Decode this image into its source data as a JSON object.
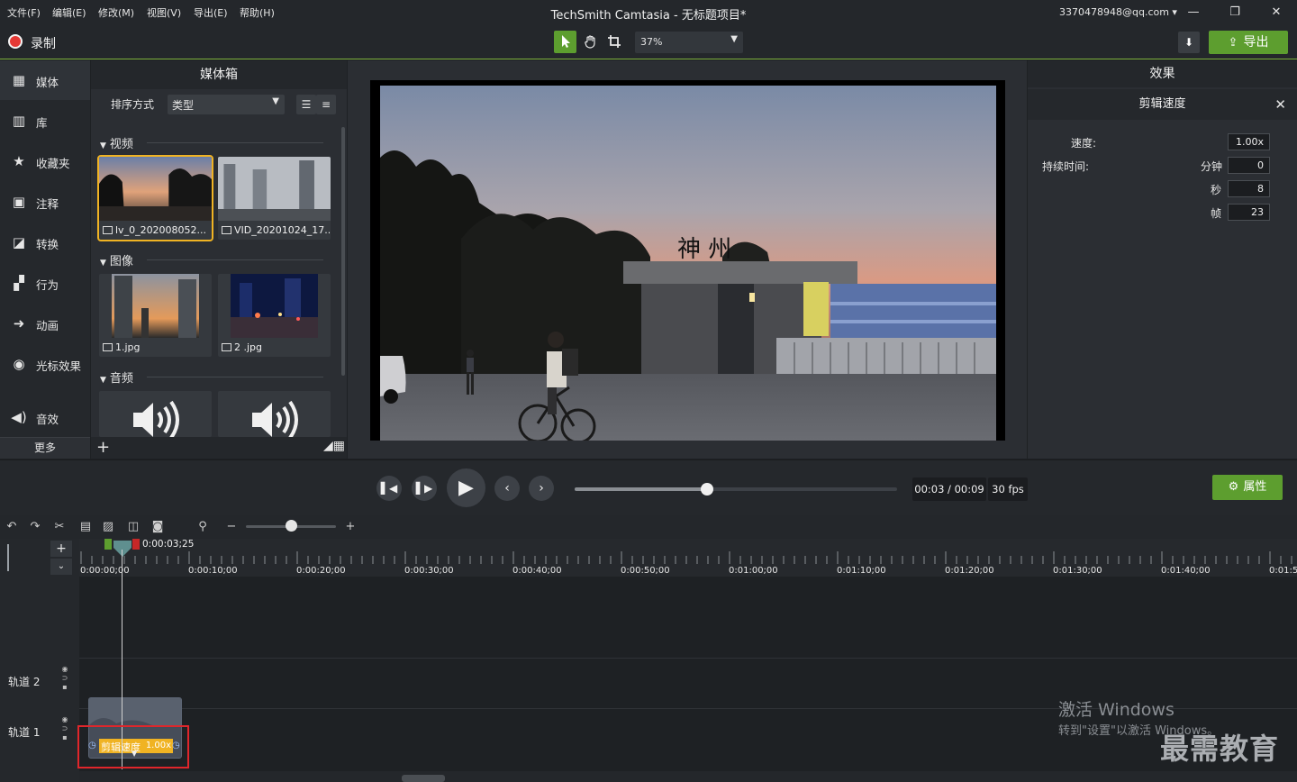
{
  "menu": [
    "文件(F)",
    "编辑(E)",
    "修改(M)",
    "视图(V)",
    "导出(E)",
    "帮助(H)"
  ],
  "app_title": "TechSmith Camtasia - 无标题项目*",
  "account": "3370478948@qq.com ▾",
  "window_controls": {
    "minimize": "—",
    "restore": "❐",
    "close": "✕"
  },
  "toolbar": {
    "record_label": "录制",
    "zoom": "37%",
    "export_label": "导出"
  },
  "nav": [
    {
      "label": "媒体",
      "icon": "media-icon"
    },
    {
      "label": "库",
      "icon": "library-icon"
    },
    {
      "label": "收藏夹",
      "icon": "star-icon"
    },
    {
      "label": "注释",
      "icon": "annotation-icon"
    },
    {
      "label": "转换",
      "icon": "transition-icon"
    },
    {
      "label": "行为",
      "icon": "behavior-icon"
    },
    {
      "label": "动画",
      "icon": "animation-icon"
    },
    {
      "label": "光标效果",
      "icon": "cursor-effect-icon"
    },
    {
      "label": "音效",
      "icon": "audio-effect-icon"
    }
  ],
  "nav_more": "更多",
  "media_bin": {
    "title": "媒体箱",
    "sort_label": "排序方式",
    "sort_value": "类型",
    "sections": {
      "video": "视频",
      "image": "图像",
      "audio": "音频"
    },
    "videos": [
      "lv_0_202008052...",
      "VID_20201024_17..."
    ],
    "images": [
      "1.jpg",
      "2 .jpg"
    ]
  },
  "properties": {
    "title": "效果",
    "subtitle": "剪辑速度",
    "speed_label": "速度:",
    "speed_value": "1.00x",
    "duration_label": "持续时间:",
    "minutes_label": "分钟",
    "minutes_value": "0",
    "seconds_label": "秒",
    "seconds_value": "8",
    "frames_label": "帧",
    "frames_value": "23"
  },
  "playback": {
    "time": "00:03 / 00:09",
    "fps": "30 fps",
    "properties_label": "属性",
    "progress": 0.41
  },
  "timeline": {
    "playhead_time": "0:00:03;25",
    "ticks": [
      "0:00:00;00",
      "0:00:10;00",
      "0:00:20;00",
      "0:00:30;00",
      "0:00:40;00",
      "0:00:50;00",
      "0:01:00;00",
      "0:01:10;00",
      "0:01:20;00",
      "0:01:30;00",
      "0:01:40;00",
      "0:01:5"
    ],
    "tracks": [
      "轨道 2",
      "轨道 1"
    ],
    "clip_label": "剪辑速度",
    "clip_speed": "1.00x"
  },
  "watermark": {
    "line1": "激活 Windows",
    "line2": "转到\"设置\"以激活 Windows。",
    "logo": "最需教育"
  },
  "colors": {
    "accent": "#5d9e2f",
    "selection": "#f0b323",
    "highlight": "#e0262b"
  }
}
